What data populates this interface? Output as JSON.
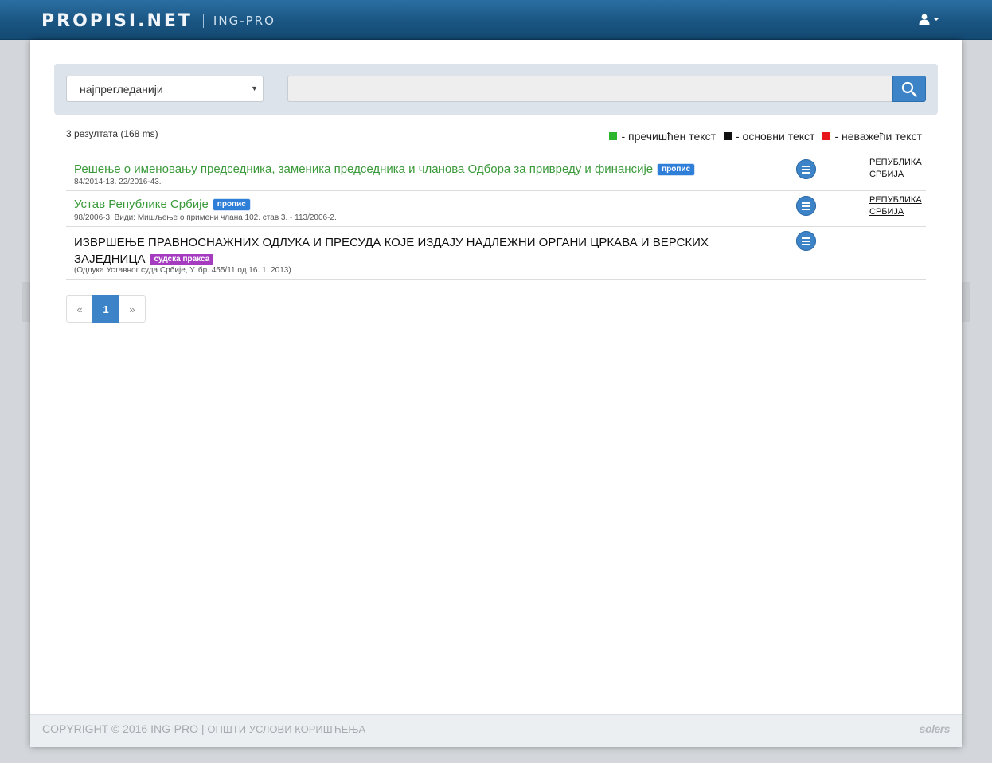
{
  "header": {
    "logo_main": "PROPISI.NET",
    "logo_sub": "ING-PRO"
  },
  "search": {
    "sort_value": "најпрегледанији",
    "query_value": "",
    "placeholder": ""
  },
  "summary": {
    "result_count": "3 резултата (168 ms)"
  },
  "legend": [
    {
      "color": "#2db52d",
      "label": "- пречишћен текст"
    },
    {
      "color": "#111111",
      "label": "- основни текст"
    },
    {
      "color": "#e8151b",
      "label": "- неважећи текст"
    }
  ],
  "results": [
    {
      "title": "Решење о именовању председника, заменика председника и чланова Одбора за привреду и финансије",
      "badge": "пропис",
      "meta": "84/2014-13. 22/2016-43.",
      "jurisdiction": "РЕПУБЛИКА СРБИЈА"
    },
    {
      "title": "Устав Републике Србије",
      "badge": "пропис",
      "meta": "98/2006-3. Види: Мишљење о примени члана 102. став 3. - 113/2006-2.",
      "jurisdiction": "РЕПУБЛИКА СРБИЈА"
    },
    {
      "title": "ИЗВРШЕЊЕ ПРАВНОСНАЖНИХ ОДЛУКА И ПРЕСУДА КОЈЕ ИЗДАЈУ НАДЛЕЖНИ ОРГАНИ ЦРКАВА И ВЕРСКИХ ЗАЈЕДНИЦА",
      "badge": "судска пракса",
      "meta": "(Одлука Уставног суда Србије, У. бр. 455/11 од 16. 1. 2013)"
    }
  ],
  "pagination": {
    "prev": "«",
    "current": "1",
    "next": "»"
  },
  "footer": {
    "copyright": "COPYRIGHT © 2016 ING-PRO",
    "separator": "|",
    "terms": "ОПШТИ УСЛОВИ КОРИШЋЕЊА",
    "brand": "solers"
  },
  "icons": {
    "user": "user-icon",
    "search": "search-icon",
    "menu": "menu-icon",
    "prev": "chevron-left-icon",
    "next": "chevron-right-icon"
  }
}
